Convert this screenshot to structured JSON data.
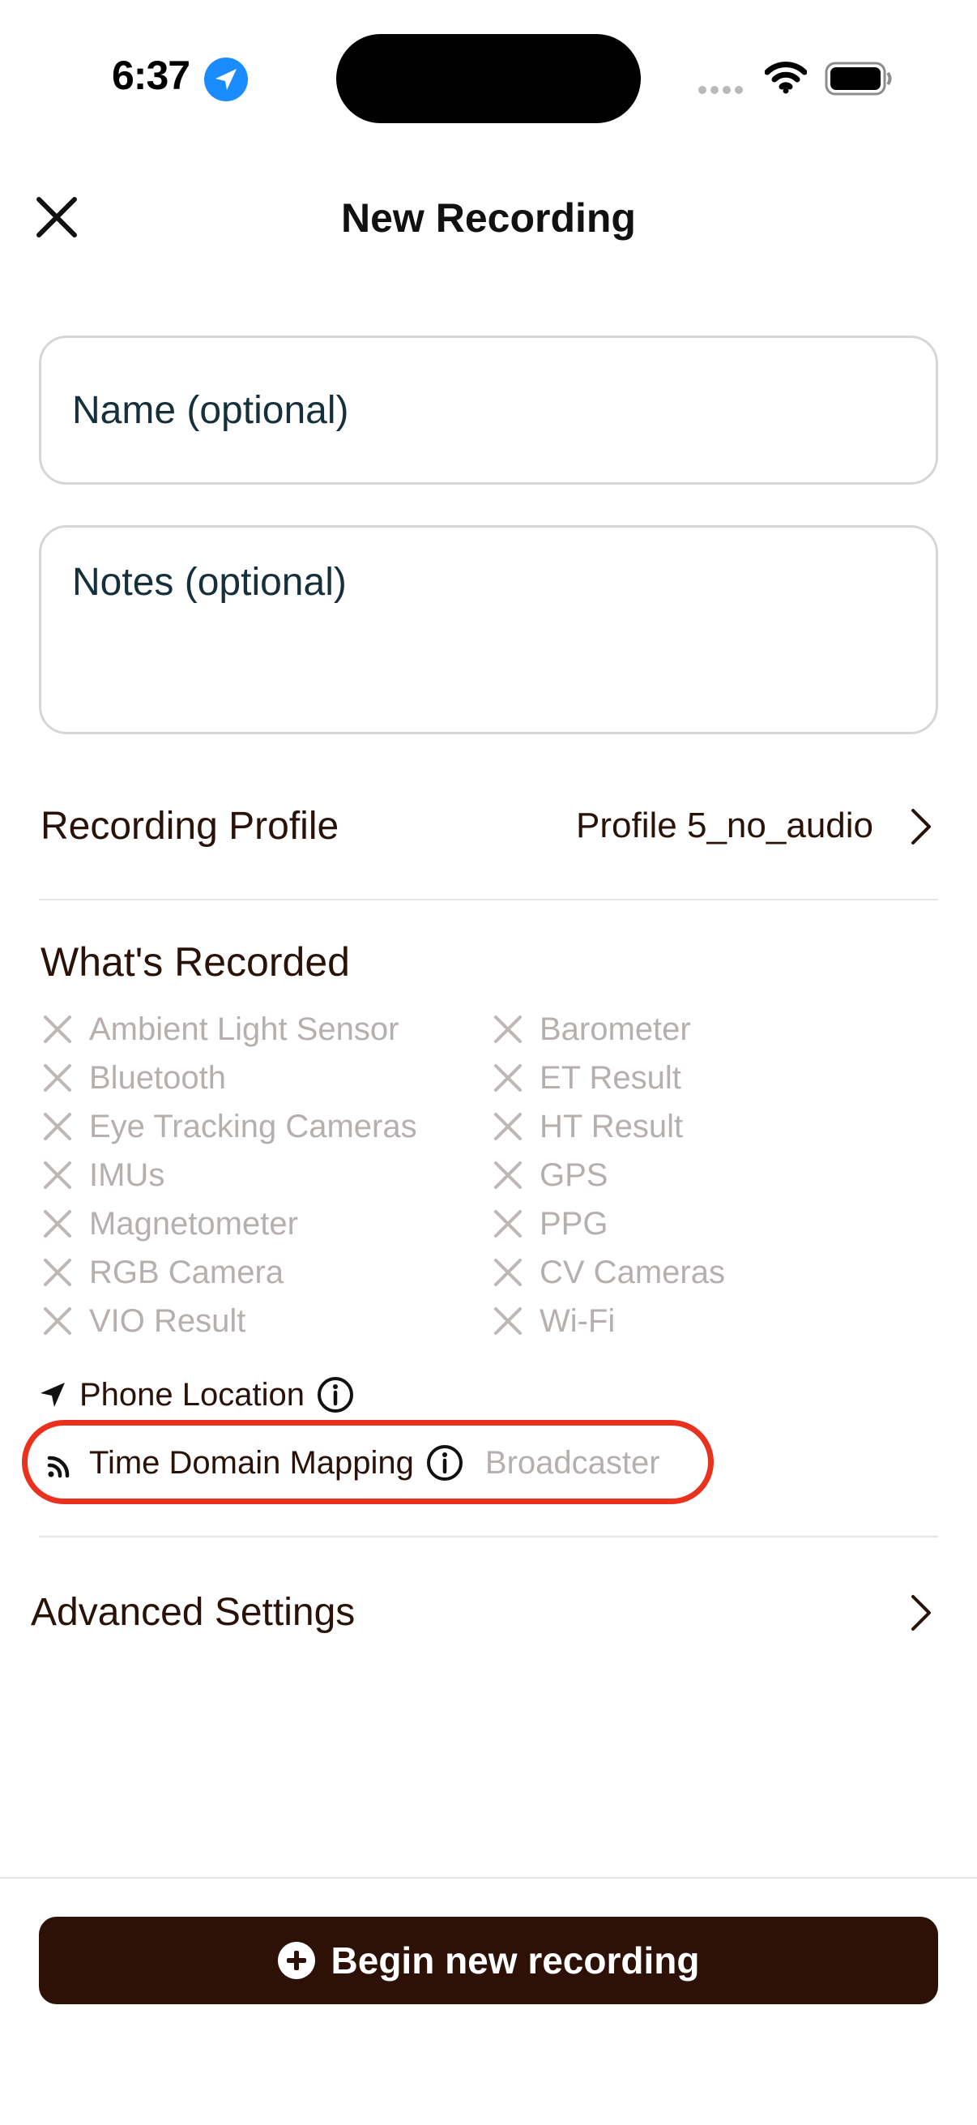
{
  "status_bar": {
    "time": "6:37",
    "location_icon": "location-arrow-icon",
    "signal_icon": "cellular-dots-icon",
    "wifi_icon": "wifi-icon",
    "battery_icon": "battery-icon"
  },
  "header": {
    "title": "New Recording",
    "close_icon": "close-icon"
  },
  "form": {
    "name_placeholder": "Name (optional)",
    "notes_placeholder": "Notes (optional)"
  },
  "recording_profile": {
    "label": "Recording Profile",
    "value": "Profile 5_no_audio",
    "chevron_icon": "chevron-right-icon"
  },
  "whats_recorded": {
    "title": "What's Recorded",
    "left_items": [
      "Ambient Light Sensor",
      "Bluetooth",
      "Eye Tracking Cameras",
      "IMUs",
      "Magnetometer",
      "RGB Camera",
      "VIO Result"
    ],
    "right_items": [
      "Barometer",
      "ET Result",
      "HT Result",
      "GPS",
      "PPG",
      "CV Cameras",
      "Wi-Fi"
    ],
    "disabled_icon": "x-mark-icon"
  },
  "phone_location": {
    "label": "Phone Location",
    "icon": "location-arrow-icon",
    "info_icon": "info-circle-icon"
  },
  "time_domain_mapping": {
    "label": "Time Domain Mapping",
    "icon": "broadcast-icon",
    "info_icon": "info-circle-icon",
    "value": "Broadcaster",
    "highlight_color": "#e8321e"
  },
  "advanced_settings": {
    "label": "Advanced Settings",
    "chevron_icon": "chevron-right-icon"
  },
  "footer": {
    "begin_label": "Begin new recording",
    "begin_icon": "plus-circle-icon",
    "button_color": "#2d1006"
  }
}
